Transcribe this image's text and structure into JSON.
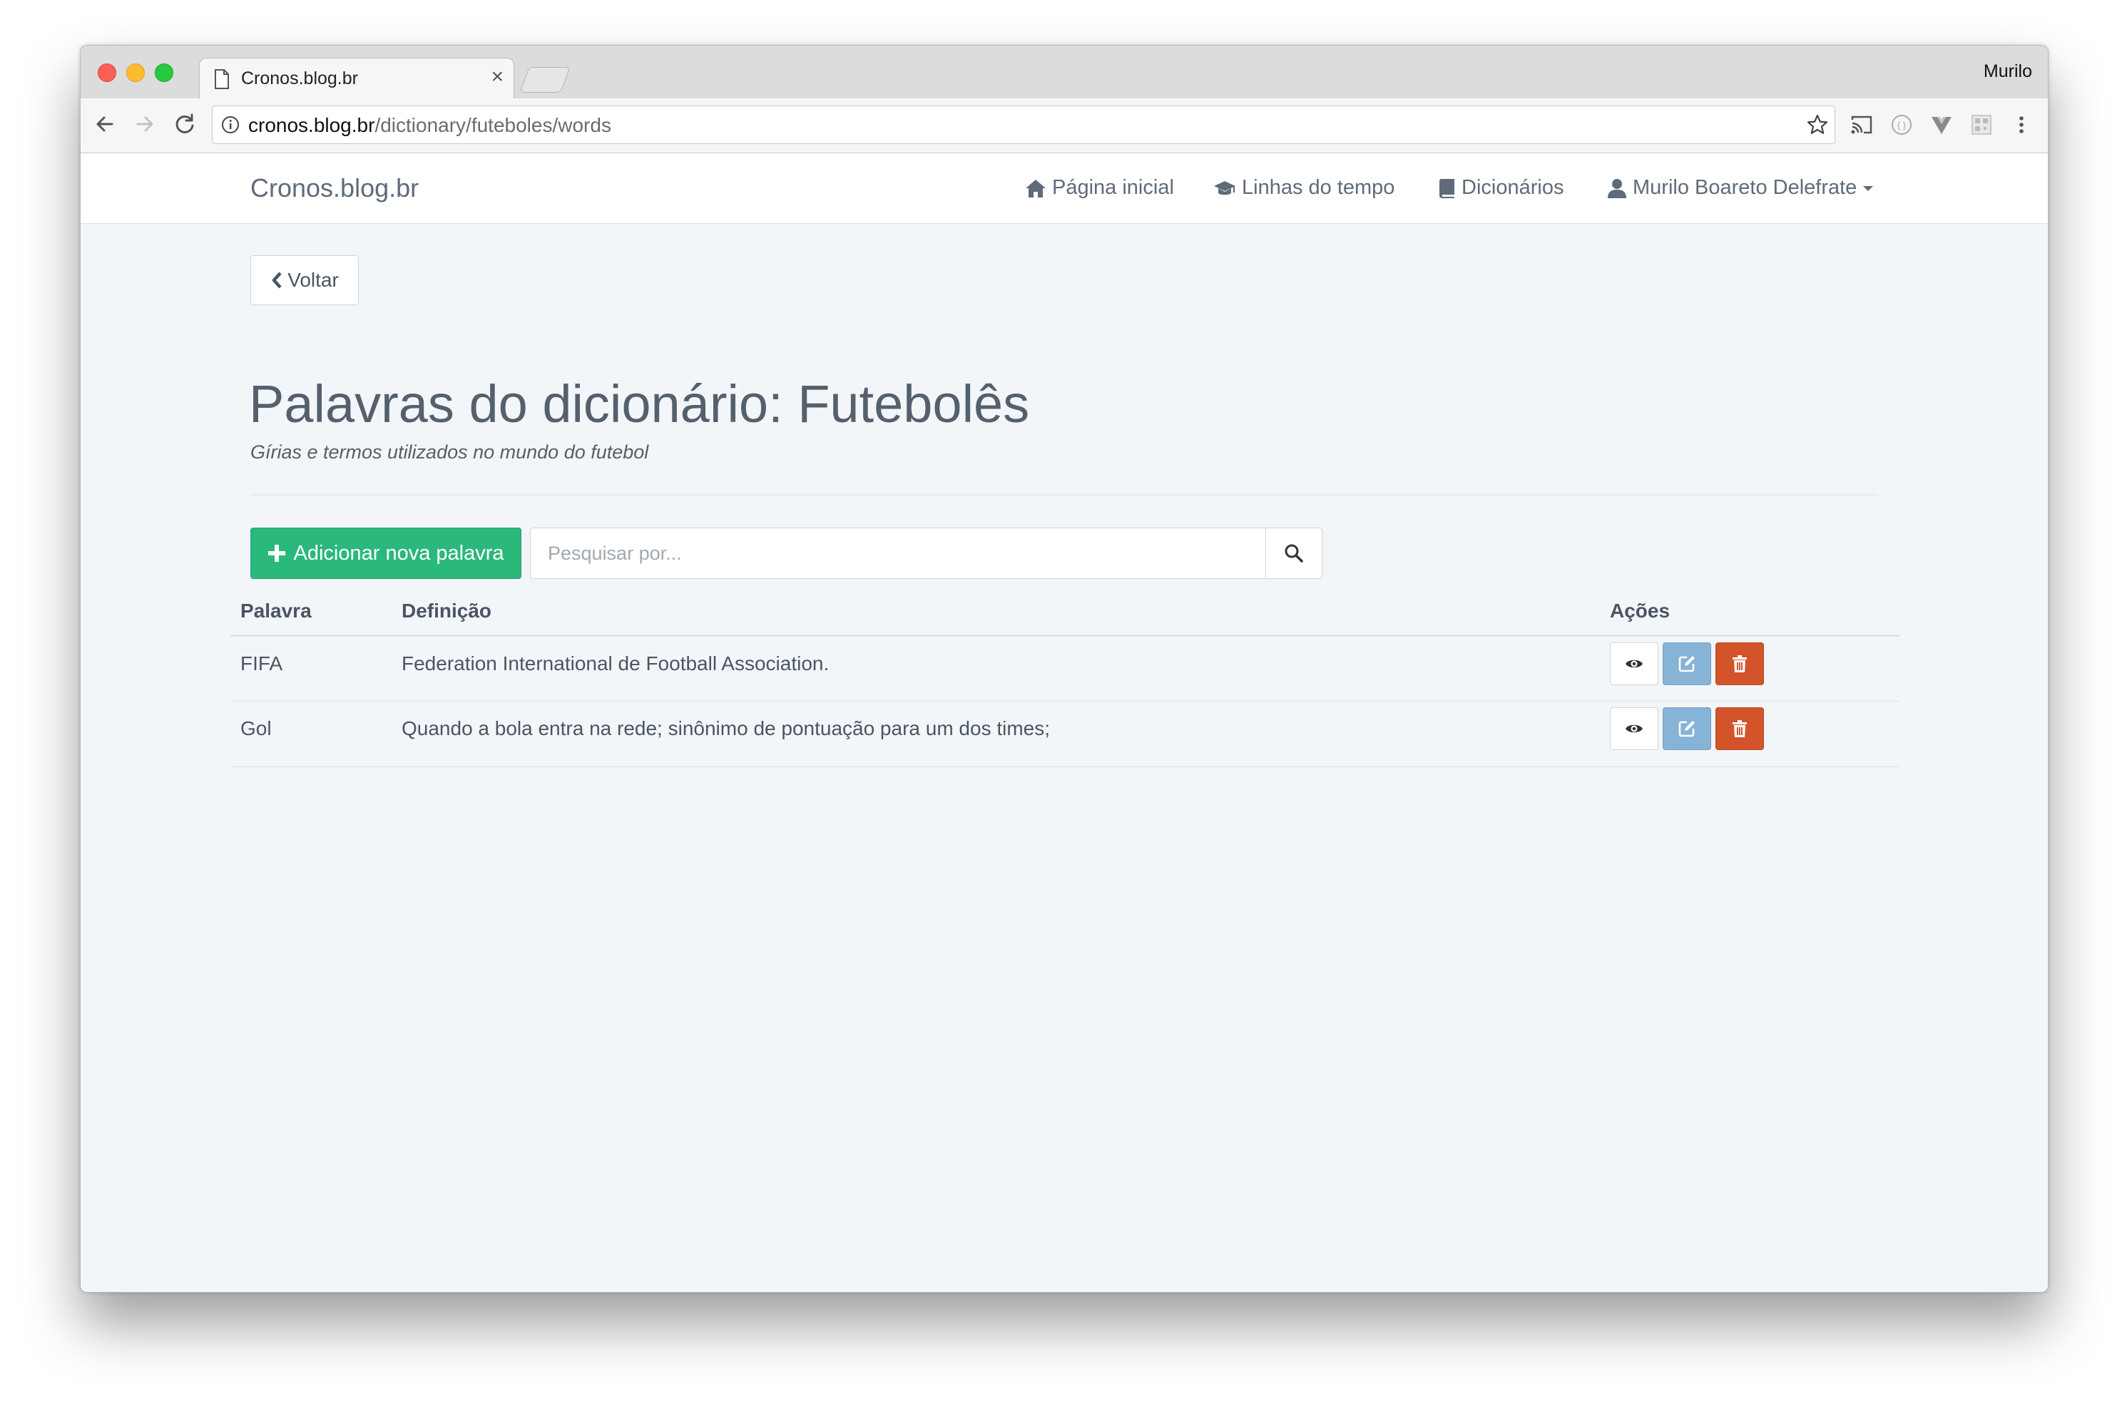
{
  "browser": {
    "tab_title": "Cronos.blog.br",
    "tab_close_glyph": "×",
    "profile_name": "Murilo",
    "url_host": "cronos.blog.br",
    "url_path": "/dictionary/futeboles/words"
  },
  "site": {
    "brand": "Cronos.blog.br",
    "nav": [
      {
        "label": "Página inicial",
        "icon": "home-icon"
      },
      {
        "label": "Linhas do tempo",
        "icon": "graduation-cap-icon"
      },
      {
        "label": "Dicionários",
        "icon": "book-icon"
      },
      {
        "label": "Murilo Boareto Delefrate",
        "icon": "user-icon"
      }
    ]
  },
  "page": {
    "back_label": "Voltar",
    "title": "Palavras do dicionário: Futebolês",
    "subtitle": "Gírias e termos utilizados no mundo do futebol",
    "add_button_label": "Adicionar nova palavra",
    "search_placeholder": "Pesquisar por..."
  },
  "table": {
    "headers": {
      "word": "Palavra",
      "definition": "Definição",
      "actions": "Ações"
    },
    "rows": [
      {
        "word": "FIFA",
        "definition": "Federation International de Football Association."
      },
      {
        "word": "Gol",
        "definition": "Quando a bola entra na rede; sinônimo de pontuação para um dos times;"
      }
    ]
  },
  "colors": {
    "primary_success": "#2bb87b",
    "info": "#86b3d6",
    "danger": "#d3542a",
    "text": "#4a5563",
    "page_bg": "#f3f6f9"
  }
}
